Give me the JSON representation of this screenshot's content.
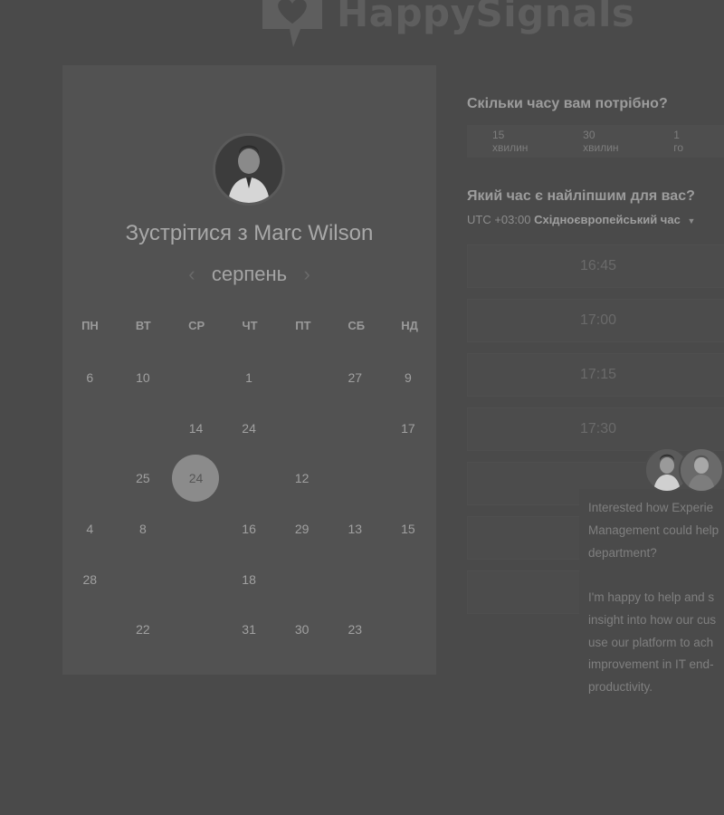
{
  "header": {
    "brand": "HappySignals",
    "logo_icon": "heart-speech-bubble-icon"
  },
  "calendar": {
    "title": "Зустрітися з Marc Wilson",
    "month": "серпень",
    "prev_icon": "chevron-left-icon",
    "next_icon": "chevron-right-icon",
    "weekdays": [
      "ПН",
      "ВТ",
      "СР",
      "ЧТ",
      "ПТ",
      "СБ",
      "НД"
    ],
    "weeks": [
      [
        "6",
        "10",
        "",
        "1",
        "",
        "27",
        "9"
      ],
      [
        "",
        "",
        "14",
        "24",
        "",
        "",
        "17"
      ],
      [
        "",
        "25",
        "24",
        "",
        "12",
        "",
        ""
      ],
      [
        "4",
        "8",
        "",
        "16",
        "29",
        "13",
        "15"
      ],
      [
        "28",
        "",
        "",
        "18",
        "",
        "",
        ""
      ],
      [
        "",
        "22",
        "",
        "31",
        "30",
        "23",
        ""
      ]
    ],
    "dim": [
      [
        false,
        false,
        true,
        false,
        true,
        false,
        false
      ],
      [
        true,
        true,
        false,
        false,
        true,
        true,
        false
      ],
      [
        true,
        false,
        false,
        true,
        false,
        true,
        true
      ],
      [
        false,
        false,
        true,
        false,
        false,
        false,
        false
      ],
      [
        false,
        true,
        true,
        false,
        true,
        true,
        true
      ],
      [
        true,
        false,
        true,
        false,
        false,
        false,
        true
      ]
    ],
    "selected": {
      "week": 2,
      "day": 2
    }
  },
  "booking": {
    "duration_question": "Скільки часу вам потрібно?",
    "durations": [
      "15 хвилин",
      "30 хвилин",
      "1 го"
    ],
    "time_question": "Який час є найліпшим для вас?",
    "timezone_offset": "UTC +03:00",
    "timezone_name": "Східноєвропейський час",
    "timezone_caret_icon": "caret-down-icon",
    "slots": [
      "16:45",
      "17:00",
      "17:15",
      "17:30",
      "",
      "",
      ""
    ]
  },
  "chat": {
    "lines1": [
      "Interested how Experie",
      "Management could help",
      "department?"
    ],
    "lines2": [
      "I'm happy to help and s",
      "insight into how our cus",
      "use our platform to ach",
      "improvement in IT end-",
      "productivity."
    ]
  }
}
